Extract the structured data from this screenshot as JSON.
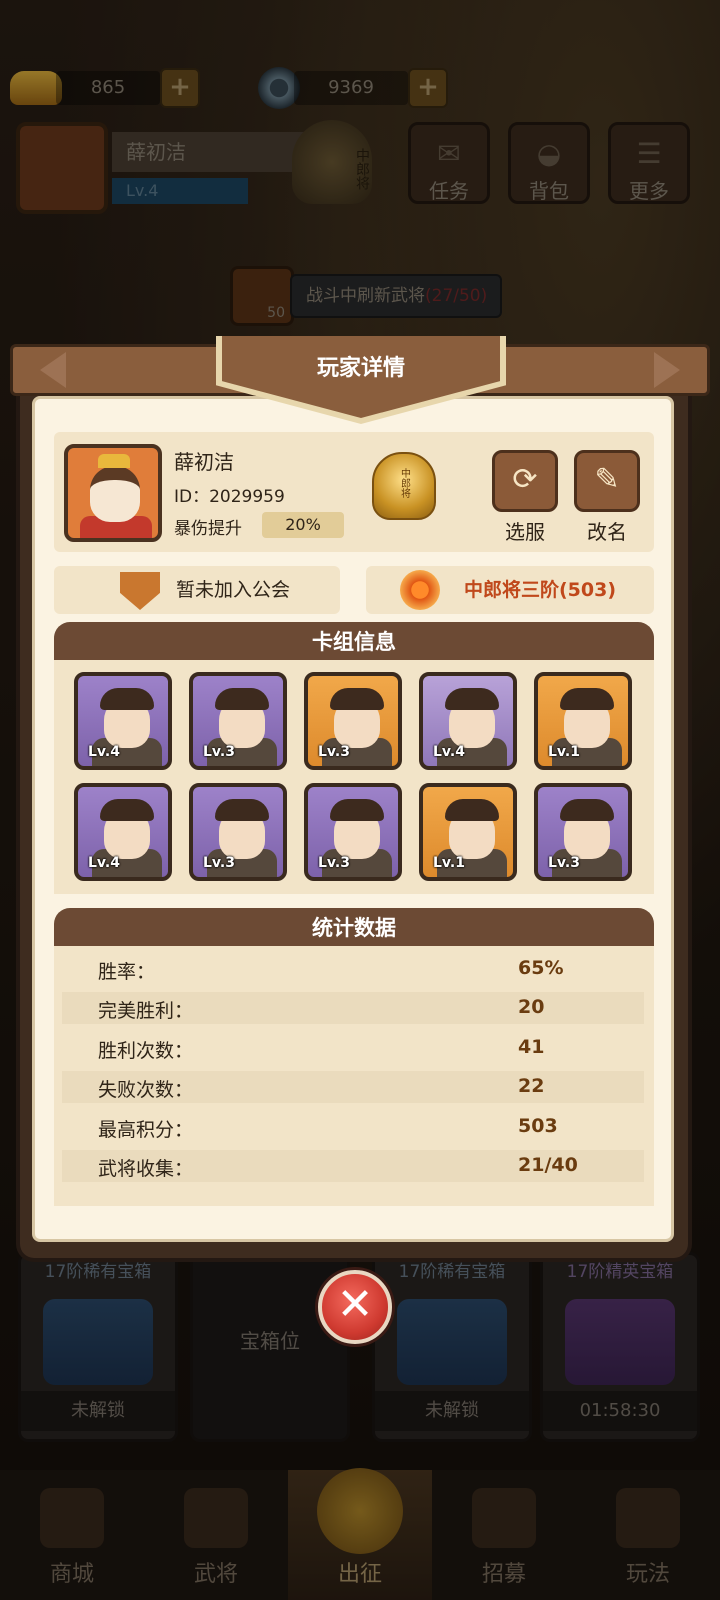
{
  "hud": {
    "gold": "865",
    "coins": "9369",
    "player_name": "薛初洁",
    "player_level": "Lv.4",
    "rank_glyph": "中郎将",
    "menu": [
      "任务",
      "背包",
      "更多"
    ],
    "refresh_count": "50",
    "refresh_label": "战斗中刷新武将",
    "refresh_progress": "(27/50)"
  },
  "modal": {
    "title": "玩家详情",
    "player": {
      "name": "薛初洁",
      "id": "ID：2029959",
      "crit_label": "暴伤提升",
      "crit_value": "20%",
      "rank_glyph": "中郎将"
    },
    "actions": {
      "server_label": "选服",
      "rename_label": "改名"
    },
    "guild_text": "暂未加入公会",
    "rank_text": "中郎将三阶(503)",
    "deck": {
      "title": "卡组信息",
      "cards": [
        {
          "level": "Lv.4",
          "color": "purple"
        },
        {
          "level": "Lv.3",
          "color": "purple"
        },
        {
          "level": "Lv.3",
          "color": "orange"
        },
        {
          "level": "Lv.4",
          "color": "silver"
        },
        {
          "level": "Lv.1",
          "color": "orange"
        },
        {
          "level": "Lv.4",
          "color": "purple"
        },
        {
          "level": "Lv.3",
          "color": "purple"
        },
        {
          "level": "Lv.3",
          "color": "purple"
        },
        {
          "level": "Lv.1",
          "color": "orange"
        },
        {
          "level": "Lv.3",
          "color": "purple"
        }
      ]
    },
    "stats": {
      "title": "统计数据",
      "rows": [
        {
          "label": "胜率：",
          "value": "65%"
        },
        {
          "label": "完美胜利：",
          "value": "20"
        },
        {
          "label": "胜利次数：",
          "value": "41"
        },
        {
          "label": "失败次数：",
          "value": "22"
        },
        {
          "label": "最高积分：",
          "value": "503"
        },
        {
          "label": "武将收集：",
          "value": "21/40"
        }
      ]
    }
  },
  "chests": [
    {
      "title": "17阶稀有宝箱",
      "status": "未解锁"
    },
    {
      "title": "",
      "status": "宝箱位"
    },
    {
      "title": "17阶稀有宝箱",
      "status": "未解锁"
    },
    {
      "title": "17阶精英宝箱",
      "status": "01:58:30"
    }
  ],
  "nav": [
    "商城",
    "武将",
    "出征",
    "招募",
    "玩法"
  ]
}
